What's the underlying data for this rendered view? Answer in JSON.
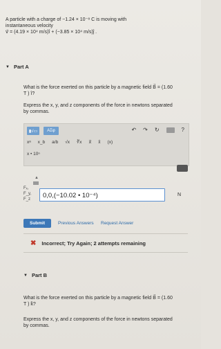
{
  "problem": {
    "line1": "A particle with a charge of −1.24 × 10⁻⁸ C is moving with",
    "line2": "instantaneous velocity",
    "line3": "v⃗ = (4.19 × 10⁴ m/s)î + (−3.85 × 10⁴ m/s)ĵ ."
  },
  "partA": {
    "title": "Part A",
    "question_line1": "What is the force exerted on this particle by a magnetic field B⃗ = (1.60",
    "question_line2": "T ) î?",
    "instructions_line1": "Express the x, y, and z components of the force in newtons separated",
    "instructions_line2": "by commas.",
    "toolbar": {
      "templates_label": "▮√▭",
      "greek_label": "ΑΣφ",
      "undo_icon": "↶",
      "redo_icon": "↷",
      "reset_icon": "↻",
      "help_icon": "?",
      "row2": [
        "xᵃ",
        "x_b",
        "a/b",
        "√x",
        "∛x",
        "x⃗",
        "x̂",
        "(x)"
      ],
      "row3": "x • 10ⁿ"
    },
    "answer_labels": [
      "Fₓ,",
      "F_y,",
      "F_z"
    ],
    "answer_value": "0,0,(−10.02 • 10⁻⁴)",
    "unit": "N",
    "submit_label": "Submit",
    "previous_answers_label": "Previous Answers",
    "request_answer_label": "Request Answer",
    "feedback": "Incorrect; Try Again; 2 attempts remaining"
  },
  "partB": {
    "title": "Part B",
    "question_line1": "What is the force exerted on this particle by a magnetic field B⃗ = (1.60",
    "question_line2": "T ) k̂?",
    "instructions_line1": "Express the x, y, and z components of the force in newtons separated",
    "instructions_line2": "by commas."
  }
}
